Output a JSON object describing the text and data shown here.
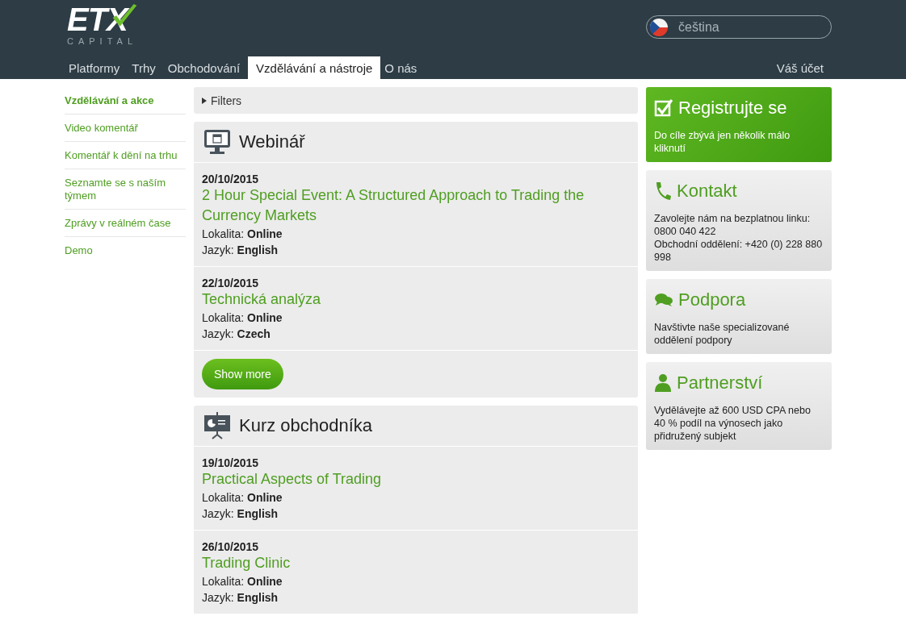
{
  "header": {
    "logo": {
      "name": "ETX",
      "tagline": "CAPITAL"
    },
    "language": {
      "label": "čeština"
    },
    "nav": [
      {
        "label": "Platformy",
        "selected": false
      },
      {
        "label": "Trhy",
        "selected": false
      },
      {
        "label": "Obchodování",
        "selected": false
      },
      {
        "label": "Vzdělávání a nástroje",
        "selected": true
      },
      {
        "label": "O nás",
        "selected": false
      }
    ],
    "account": "Váš účet"
  },
  "sidebar": {
    "items": [
      {
        "label": "Vzdělávání a akce",
        "selected": true
      },
      {
        "label": "Video komentář",
        "selected": false
      },
      {
        "label": "Komentář k dění na trhu",
        "selected": false
      },
      {
        "label": "Seznamte se s naším týmem",
        "selected": false
      },
      {
        "label": "Zprávy v reálném čase",
        "selected": false
      },
      {
        "label": "Demo",
        "selected": false
      }
    ]
  },
  "filters": {
    "label": "Filters",
    "expanded": false
  },
  "sections": [
    {
      "kind": "webinar",
      "title": "Webinář",
      "show_more": "Show more",
      "events": [
        {
          "date": "20/10/2015",
          "title": "2 Hour Special Event: A Structured Approach to Trading the Currency Markets",
          "location_label": "Lokalita:",
          "location": "Online",
          "language_label": "Jazyk:",
          "language": "English"
        },
        {
          "date": "22/10/2015",
          "title": "Technická analýza",
          "location_label": "Lokalita:",
          "location": "Online",
          "language_label": "Jazyk:",
          "language": "Czech"
        }
      ]
    },
    {
      "kind": "course",
      "title": "Kurz obchodníka",
      "events": [
        {
          "date": "19/10/2015",
          "title": "Practical Aspects of Trading",
          "location_label": "Lokalita:",
          "location": "Online",
          "language_label": "Jazyk:",
          "language": "English"
        },
        {
          "date": "26/10/2015",
          "title": "Trading Clinic",
          "location_label": "Lokalita:",
          "location": "Online",
          "language_label": "Jazyk:",
          "language": "English"
        }
      ]
    }
  ],
  "promos": [
    {
      "kind": "register",
      "title": "Registrujte se",
      "lines": [
        "Do cíle zbývá jen několik málo kliknutí"
      ]
    },
    {
      "kind": "contact",
      "title": "Kontakt",
      "lines": [
        "Zavolejte nám na bezplatnou linku: 0800 040 422",
        "Obchodní oddělení: +420 (0) 228 880 998"
      ]
    },
    {
      "kind": "support",
      "title": "Podpora",
      "lines": [
        "Navštivte naše specializované oddělení podpory"
      ]
    },
    {
      "kind": "partner",
      "title": "Partnerství",
      "lines": [
        "Vydělávejte až 600 USD CPA nebo 40 % podíl na výnosech jako přidružený subjekt"
      ]
    }
  ]
}
